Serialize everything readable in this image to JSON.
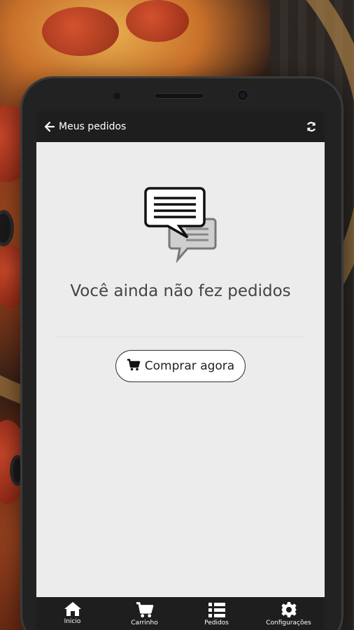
{
  "appbar": {
    "title": "Meus pedidos",
    "back_icon": "arrow-left-icon",
    "refresh_icon": "refresh-icon"
  },
  "empty_state": {
    "icon": "chat-messages-icon",
    "message": "Você ainda não fez pedidos",
    "button_label": "Comprar agora",
    "button_icon": "cart-icon"
  },
  "tabbar": {
    "items": [
      {
        "label": "Inicio",
        "icon": "home-icon"
      },
      {
        "label": "Carrinho",
        "icon": "cart-icon"
      },
      {
        "label": "Pedidos",
        "icon": "list-icon"
      },
      {
        "label": "Configurações",
        "icon": "gear-icon"
      }
    ]
  },
  "colors": {
    "appbar_bg": "#1e1e1e",
    "screen_bg": "#ececec",
    "text_primary": "#444444"
  }
}
